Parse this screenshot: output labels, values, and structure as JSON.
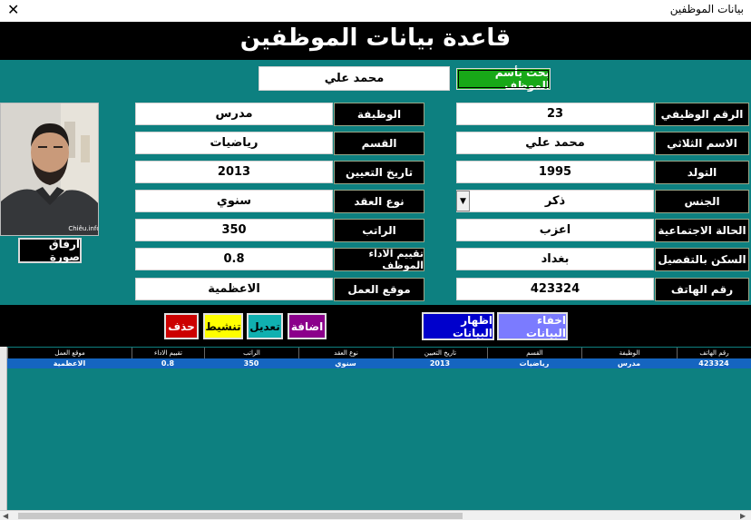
{
  "window": {
    "title": "بيانات الموظفين",
    "close_glyph": "✕"
  },
  "header": {
    "title": "قاعدة بيانات الموظفين"
  },
  "search": {
    "value": "محمد علي",
    "button_label": "بحث بأسم الموظف"
  },
  "photo": {
    "attach_label": "ارفاق صورة",
    "watermark": "Chiêu.info"
  },
  "fields": {
    "employee_no": {
      "label": "الرقم الوظيفي",
      "value": "23"
    },
    "full_name": {
      "label": "الاسم الثلاثي",
      "value": "محمد علي"
    },
    "birth": {
      "label": "التولد",
      "value": "1995"
    },
    "gender": {
      "label": "الجنس",
      "value": "ذكر"
    },
    "marital": {
      "label": "الحالة الاجتماعية",
      "value": "اعزب"
    },
    "address": {
      "label": "السكن بالتفصيل",
      "value": "بغداد"
    },
    "phone": {
      "label": "رقم الهاتف",
      "value": "423324"
    },
    "job": {
      "label": "الوظيفة",
      "value": "مدرس"
    },
    "department": {
      "label": "القسم",
      "value": "رياضيات"
    },
    "hire_date": {
      "label": "تاريخ التعيين",
      "value": "2013"
    },
    "contract": {
      "label": "نوع العقد",
      "value": "سنوي"
    },
    "salary": {
      "label": "الراتب",
      "value": "350"
    },
    "rating": {
      "label": "تقييم الاداء الموظف",
      "value": "0.8"
    },
    "work_site": {
      "label": "موقع العمل",
      "value": "الاعظمية"
    }
  },
  "buttons": {
    "hide": "اخفاء البيانات",
    "show": "اظهار البيانات",
    "add": "اضافة",
    "edit": "تعديل",
    "refresh": "تنشيط",
    "delete": "حذف"
  },
  "grid": {
    "columns": [
      "رقم الهاتف",
      "الوظيفة",
      "القسم",
      "تاريخ التعيين",
      "نوع العقد",
      "الراتب",
      "تقييم الاداء",
      "موقع العمل"
    ],
    "rows": [
      [
        "423324",
        "مدرس",
        "رياضيات",
        "2013",
        "سنوي",
        "350",
        "0.8",
        "الاعظمية"
      ]
    ]
  },
  "colors": {
    "form_bg": "#0d8080",
    "search_button": "#18a818",
    "hide_button": "#7b7bff",
    "show_button": "#0000cc",
    "add_button": "#8b008b",
    "edit_button": "#10b0b0",
    "refresh_button": "#ffff00",
    "delete_button": "#cc0000",
    "selected_row": "#1565c0"
  }
}
